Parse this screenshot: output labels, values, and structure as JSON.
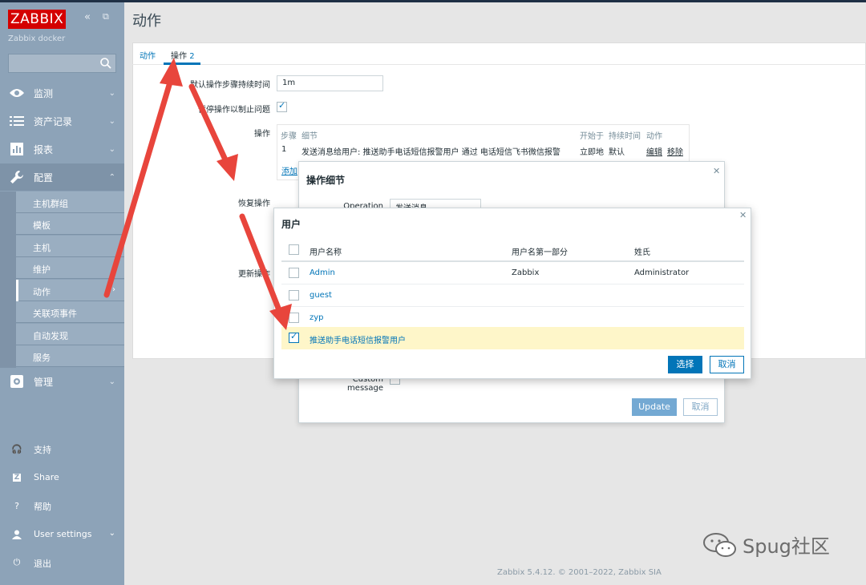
{
  "app": {
    "logo_text": "ZABBIX",
    "collapse_glyph": "«",
    "expand_glyph": "⧉",
    "server_name": "Zabbix docker",
    "page_title": "动作"
  },
  "sidebar": {
    "main_items": [
      {
        "label": "监测",
        "icon": "eye-icon"
      },
      {
        "label": "资产记录",
        "icon": "list-icon"
      },
      {
        "label": "报表",
        "icon": "chart-icon"
      },
      {
        "label": "配置",
        "icon": "wrench-icon"
      },
      {
        "label": "管理",
        "icon": "gear-icon"
      }
    ],
    "sub_items": [
      "主机群组",
      "模板",
      "主机",
      "维护",
      "动作",
      "关联项事件",
      "自动发现",
      "服务"
    ],
    "bottom_items": [
      {
        "label": "支持",
        "icon": "headset-icon"
      },
      {
        "label": "Share",
        "icon": "share-icon"
      },
      {
        "label": "帮助",
        "icon": "help-icon"
      },
      {
        "label": "User settings",
        "icon": "user-icon"
      },
      {
        "label": "退出",
        "icon": "power-icon"
      }
    ]
  },
  "tabs": [
    {
      "label": "动作"
    },
    {
      "label": "操作",
      "count": "2"
    }
  ],
  "form": {
    "step_duration_label": "默认操作步骤持续时间",
    "step_duration_value": "1m",
    "pause_label": "暂停操作以制止问题",
    "operations_label": "操作",
    "recovery_label": "恢复操作",
    "update_label": "更新操作",
    "ops_columns": {
      "step": "步骤",
      "detail": "细节",
      "start": "开始于",
      "duration": "持续时间",
      "action": "动作"
    },
    "ops_row": {
      "step": "1",
      "detail": "发送消息给用户: 推送助手电话短信报警用户 通过 电话短信飞书微信报警",
      "start": "立即地",
      "duration": "默认",
      "edit": "编辑",
      "remove": "移除"
    },
    "add_link": "添加",
    "detail_partial": "细节"
  },
  "dialog_operation": {
    "title": "操作细节",
    "operation_label": "Operation",
    "operation_value": "发送消息",
    "custom_message_label": "Custom message",
    "update_button": "Update",
    "cancel_button": "取消"
  },
  "dialog_users": {
    "title": "用户",
    "columns": {
      "username": "用户名称",
      "firstname": "用户名第一部分",
      "surname": "姓氏"
    },
    "rows": [
      {
        "username": "Admin",
        "firstname": "Zabbix",
        "surname": "Administrator",
        "checked": false
      },
      {
        "username": "guest",
        "firstname": "",
        "surname": "",
        "checked": false
      },
      {
        "username": "zyp",
        "firstname": "",
        "surname": "",
        "checked": false
      },
      {
        "username": "推送助手电话短信报警用户",
        "firstname": "",
        "surname": "",
        "checked": true
      }
    ],
    "select_button": "选择",
    "cancel_button": "取消"
  },
  "footer": {
    "text": "Zabbix 5.4.12. © 2001–2022, Zabbix SIA"
  },
  "watermark": {
    "text": "Spug社区"
  },
  "colors": {
    "accent": "#0275b8",
    "sidebar": "#8da3b8",
    "logo": "#d40000",
    "arrow": "#e8453c",
    "selected_row": "#fef6c9"
  }
}
